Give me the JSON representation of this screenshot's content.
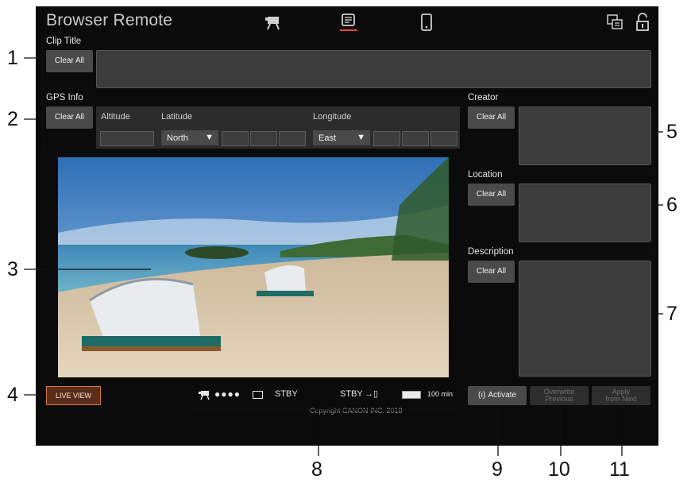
{
  "app": {
    "title": "Browser Remote"
  },
  "clip_title": {
    "label": "Clip Title",
    "clear_label": "Clear All"
  },
  "gps": {
    "label": "GPS Info",
    "clear_label": "Clear All",
    "altitude_label": "Altitude",
    "latitude_label": "Latitude",
    "longitude_label": "Longitude",
    "latitude_dir": "North",
    "longitude_dir": "East"
  },
  "creator": {
    "label": "Creator",
    "clear_label": "Clear All"
  },
  "location": {
    "label": "Location",
    "clear_label": "Clear All"
  },
  "description": {
    "label": "Description",
    "clear_label": "Clear All"
  },
  "live_view_label": "LIVE VIEW",
  "status": {
    "left_stby": "STBY",
    "right_stby": "STBY",
    "remaining": "100 min"
  },
  "copyright": "Copyright CANON INC. 2018",
  "buttons": {
    "activate": "Activate",
    "overwrite_line1": "Overwrite",
    "overwrite_line2": "Previous",
    "apply_line1": "Apply",
    "apply_line2": "from Next"
  },
  "callouts": [
    "1",
    "2",
    "3",
    "4",
    "5",
    "6",
    "7",
    "8",
    "9",
    "10",
    "11"
  ],
  "colors": {
    "active_tab": "#e0453a",
    "live_view_border": "#d4774a"
  },
  "icons": [
    "camera-mode-icon",
    "metadata-mode-icon",
    "phone-icon",
    "screen-switch-icon",
    "lock-icon"
  ]
}
